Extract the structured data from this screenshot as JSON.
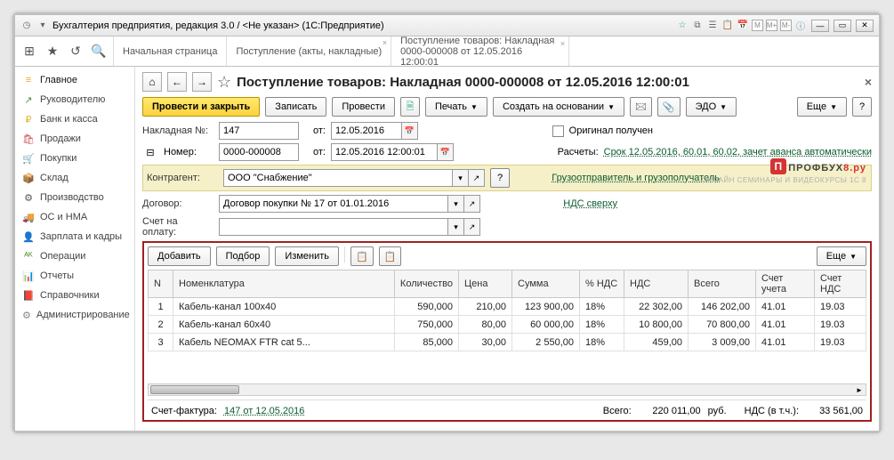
{
  "window_title": "Бухгалтерия предприятия, редакция 3.0 / <Не указан>   (1С:Предприятие)",
  "topbar_icons": {
    "grid": "⊞",
    "star": "★",
    "history": "↺",
    "search": "🔍"
  },
  "tabs": [
    {
      "label": "Начальная страница"
    },
    {
      "label": "Поступление (акты, накладные)"
    },
    {
      "label": "Поступление товаров: Накладная 0000-000008 от 12.05.2016 12:00:01"
    }
  ],
  "sidebar": [
    {
      "icon": "≡",
      "label": "Главное",
      "color": "#f5a623"
    },
    {
      "icon": "↗",
      "label": "Руководителю",
      "color": "#5a8f3a"
    },
    {
      "icon": "₽",
      "label": "Банк и касса",
      "color": "#e2b93b"
    },
    {
      "icon": "🛍",
      "label": "Продажи",
      "color": "#c94a4a"
    },
    {
      "icon": "🛒",
      "label": "Покупки",
      "color": "#4a7fc9"
    },
    {
      "icon": "📦",
      "label": "Склад",
      "color": "#7a5fa8"
    },
    {
      "icon": "⚙",
      "label": "Производство",
      "color": "#555"
    },
    {
      "icon": "🚚",
      "label": "ОС и НМА",
      "color": "#555"
    },
    {
      "icon": "👤",
      "label": "Зарплата и кадры",
      "color": "#555"
    },
    {
      "icon": "ᴬᴷ",
      "label": "Операции",
      "color": "#5a8f3a"
    },
    {
      "icon": "📊",
      "label": "Отчеты",
      "color": "#4a7fc9"
    },
    {
      "icon": "📕",
      "label": "Справочники",
      "color": "#d67a2a"
    },
    {
      "icon": "⚙",
      "label": "Администрирование",
      "color": "#888"
    }
  ],
  "doc": {
    "title": "Поступление товаров: Накладная 0000-000008 от 12.05.2016 12:00:01",
    "toolbar": {
      "provesti_zakryt": "Провести и закрыть",
      "zapisat": "Записать",
      "provesti": "Провести",
      "pechat": "Печать",
      "sozdat": "Создать на основании",
      "edo": "ЭДО",
      "esche": "Еще"
    },
    "nakladnaya_lbl": "Накладная №:",
    "nakladnaya_val": "147",
    "nakl_ot_lbl": "от:",
    "nakl_date": "12.05.2016",
    "nomer_lbl": "Номер:",
    "nomer_val": "0000-000008",
    "nomer_ot": "от:",
    "nomer_date": "12.05.2016 12:00:01",
    "original_lbl": "Оригинал получен",
    "raschety_lbl": "Расчеты:",
    "raschety_link": "Срок 12.05.2016, 60.01, 60.02, зачет аванса автоматически",
    "contragent_lbl": "Контрагент:",
    "contragent_val": "ООО \"Снабжение\"",
    "gruz_link": "Грузоотправитель и грузополучатель",
    "dogovor_lbl": "Договор:",
    "dogovor_val": "Договор покупки № 17 от 01.01.2016",
    "nds_link": "НДС сверху",
    "schet_lbl": "Счет на оплату:",
    "tbl_toolbar": {
      "dobavit": "Добавить",
      "podbor": "Подбор",
      "izmenit": "Изменить",
      "esche": "Еще"
    },
    "columns": {
      "n": "N",
      "nom": "Номенклатура",
      "qty": "Количество",
      "price": "Цена",
      "sum": "Сумма",
      "pct": "% НДС",
      "nds": "НДС",
      "total": "Всего",
      "acc": "Счет учета",
      "accnds": "Счет НДС"
    },
    "rows": [
      {
        "n": "1",
        "nom": "Кабель-канал 100х40",
        "qty": "590,000",
        "price": "210,00",
        "sum": "123 900,00",
        "pct": "18%",
        "nds": "22 302,00",
        "total": "146 202,00",
        "acc": "41.01",
        "accnds": "19.03"
      },
      {
        "n": "2",
        "nom": "Кабель-канал 60х40",
        "qty": "750,000",
        "price": "80,00",
        "sum": "60 000,00",
        "pct": "18%",
        "nds": "10 800,00",
        "total": "70 800,00",
        "acc": "41.01",
        "accnds": "19.03"
      },
      {
        "n": "3",
        "nom": "Кабель NEOMAX FTR cat 5...",
        "qty": "85,000",
        "price": "30,00",
        "sum": "2 550,00",
        "pct": "18%",
        "nds": "459,00",
        "total": "3 009,00",
        "acc": "41.01",
        "accnds": "19.03"
      }
    ],
    "footer": {
      "sf_lbl": "Счет-фактура:",
      "sf_link": "147 от 12.05.2016",
      "vsego_lbl": "Всего:",
      "vsego_val": "220 011,00",
      "rub": "руб.",
      "nds_lbl": "НДС (в т.ч.):",
      "nds_val": "33 561,00"
    }
  },
  "logo": {
    "main1": "ПРОФБУХ",
    "main2": "8",
    "main3": ".ру",
    "sub": "ОНЛАЙН СЕМИНАРЫ И ВИДЕОКУРСЫ 1С 8"
  }
}
